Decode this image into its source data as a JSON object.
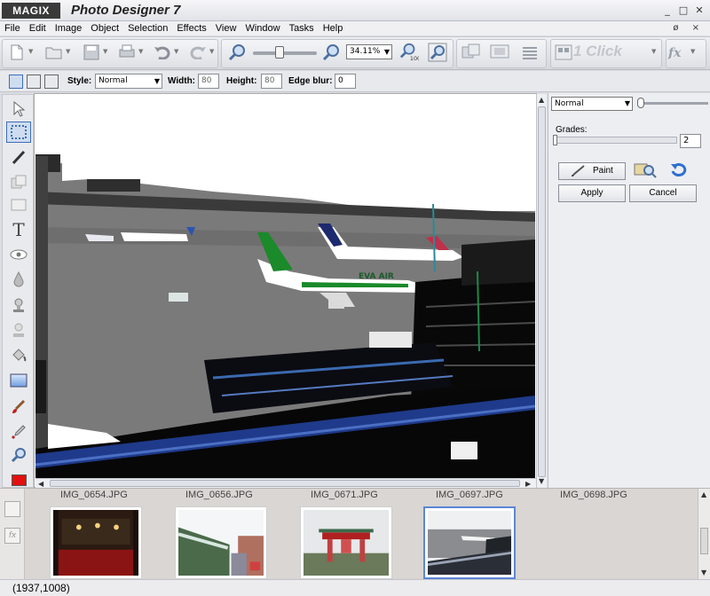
{
  "app": {
    "logo": "MAGIX",
    "title": "Photo Designer 7",
    "window_controls": [
      "_",
      "□",
      "✕"
    ]
  },
  "menu": {
    "items": [
      "File",
      "Edit",
      "Image",
      "Object",
      "Selection",
      "Effects",
      "View",
      "Window",
      "Tasks",
      "Help"
    ],
    "right_controls": "ø ×"
  },
  "toolbar": {
    "zoom_value": "34.11%",
    "one_click_label": "1 Click"
  },
  "options": {
    "style_label": "Style:",
    "style_value": "Normal",
    "width_label": "Width:",
    "width_value": "80",
    "height_label": "Height:",
    "height_value": "80",
    "edge_blur_label": "Edge blur:",
    "edge_blur_value": "0"
  },
  "panel": {
    "blend_mode": "Normal",
    "grades_label": "Grades:",
    "grades_value": "2",
    "paint_label": "Paint",
    "apply_label": "Apply",
    "cancel_label": "Cancel"
  },
  "filmstrip": {
    "items": [
      {
        "name": "IMG_0654.JPG",
        "selected": false
      },
      {
        "name": "IMG_0656.JPG",
        "selected": false
      },
      {
        "name": "IMG_0671.JPG",
        "selected": false
      },
      {
        "name": "IMG_0697.JPG",
        "selected": true
      },
      {
        "name": "IMG_0698.JPG",
        "selected": false
      }
    ]
  },
  "status": {
    "dimensions": "(1937,1008)"
  },
  "photo": {
    "airline_text": "EVA AIR"
  },
  "colors": {
    "active_tool_border": "#3a6fb8",
    "selected_thumb_border": "#5b86d8",
    "foreground_swatch": "#e21010",
    "photo_sky": "#ffffff",
    "photo_tarmac": "#7a7a7a",
    "airline_green": "#1a8a2a"
  }
}
